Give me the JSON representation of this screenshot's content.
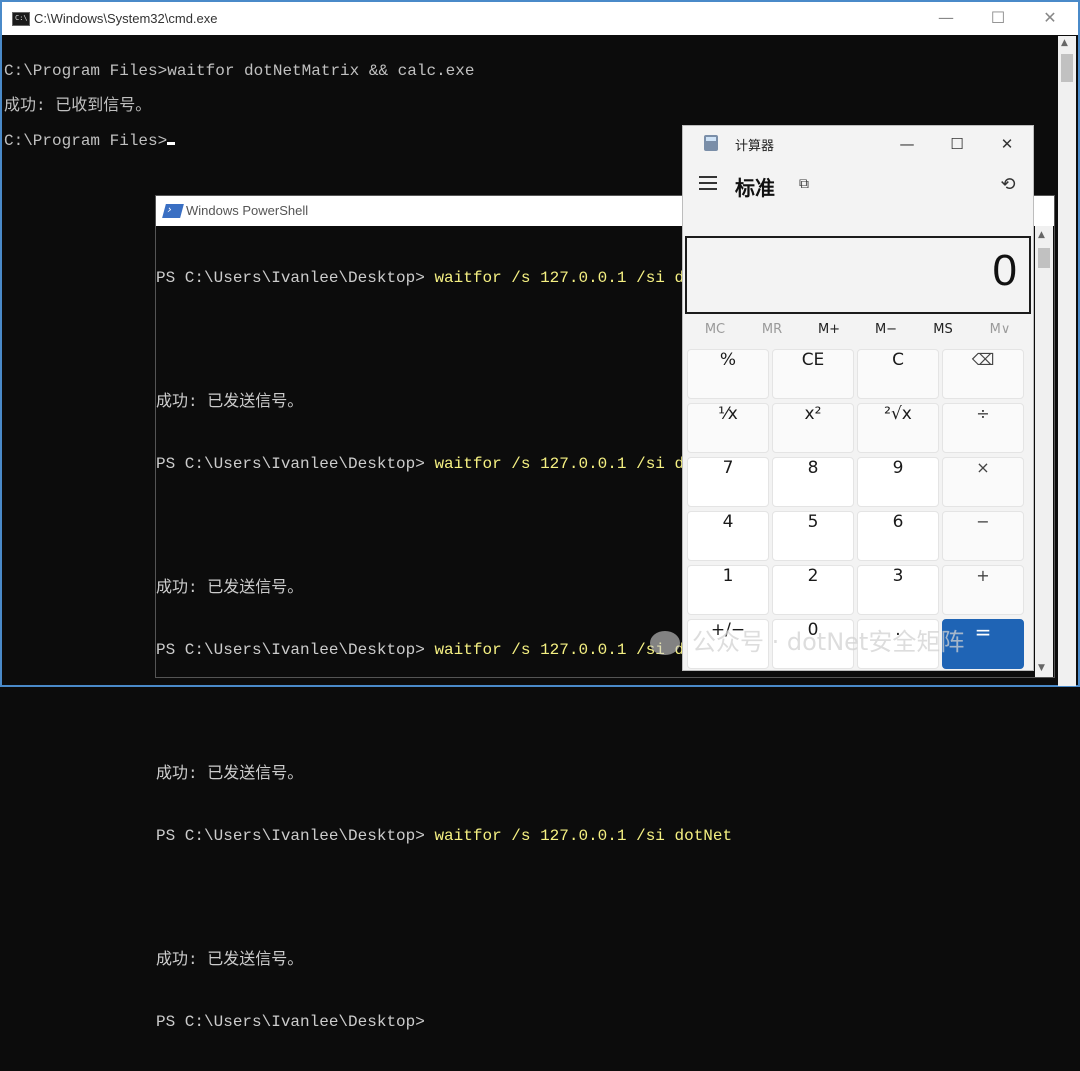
{
  "cmd": {
    "title": "C:\\Windows\\System32\\cmd.exe",
    "icon_text": "C:\\",
    "lines": [
      "C:\\Program Files>waitfor dotNetMatrix && calc.exe",
      "成功: 已收到信号。",
      "C:\\Program Files>"
    ],
    "buttons": {
      "minimize": "—",
      "maximize": "☐",
      "close": "✕"
    }
  },
  "powershell": {
    "title": "Windows PowerShell",
    "prompt": "PS C:\\Users\\Ivanlee\\Desktop> ",
    "command_visible": "waitfor /s 127.0.0.1 /si dotNet",
    "success": "成功: 已发送信号。",
    "icon_glyph": "›"
  },
  "calculator": {
    "title": "计算器",
    "mode": "标准",
    "display": "0",
    "titlebar_buttons": {
      "minimize": "—",
      "maximize": "☐",
      "close": "✕"
    },
    "icons": {
      "menu": "hamburger-icon",
      "keep_on_top": "⧉",
      "history": "⟲"
    },
    "memory": [
      "MC",
      "MR",
      "M+",
      "M−",
      "MS",
      "M∨"
    ],
    "memory_enabled": [
      false,
      false,
      true,
      true,
      true,
      false
    ],
    "keys": [
      [
        "%",
        "CE",
        "C",
        "⌫"
      ],
      [
        "⅟x",
        "x²",
        "²√x",
        "÷"
      ],
      [
        "7",
        "8",
        "9",
        "×"
      ],
      [
        "4",
        "5",
        "6",
        "−"
      ],
      [
        "1",
        "2",
        "3",
        "+"
      ],
      [
        "+/−",
        "0",
        ".",
        "="
      ]
    ]
  },
  "watermark": "公众号 · dotNet安全矩阵",
  "colors": {
    "console_bg": "#0c0c0c",
    "ps_command": "#f5f082",
    "calc_equals": "#1f64b5",
    "cmd_border": "#4a8ac9"
  }
}
